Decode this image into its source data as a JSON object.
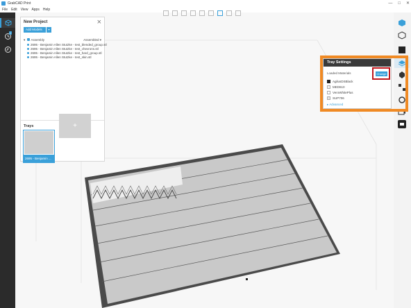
{
  "window": {
    "title": "GrabCAD Print",
    "controls": [
      "—",
      "□",
      "✕"
    ]
  },
  "menu": [
    "File",
    "Edit",
    "View",
    "Apps",
    "Help"
  ],
  "leftbar": {
    "history_badge": "1"
  },
  "project_panel": {
    "title": "New Project",
    "add_models_label": "Add Models",
    "assembly_name": "Assembly",
    "assembly_state": "Assembled",
    "models": [
      "2695 - Benjamin Allen Stutzke - test_blended_group.stl",
      "2695 - Benjamin Allen Stutzke - test_chevrons.stl",
      "2695 - Benjamin Allen Stutzke - test_hard_group.stl",
      "2695 - Benjamin Allen Stutzke - test_skin.stl"
    ],
    "trays_title": "Trays",
    "tray_label": "2695 - Benjamin ...",
    "tray_add_symbol": "+"
  },
  "tray_settings": {
    "title": "Tray Settings",
    "loaded_materials_label": "Loaded Materials",
    "change_label": "Change",
    "materials": [
      {
        "name": "AgilusDSBlack",
        "color": "#222222"
      },
      {
        "name": "MED610",
        "color": "#f2f2f2"
      },
      {
        "name": "VeroWhitePlus",
        "color": "#ffffff"
      },
      {
        "name": "SUP706",
        "color": "#e6e6e6"
      }
    ],
    "advanced_label": "▸ Advanced"
  },
  "colors": {
    "accent": "#3aa0d9",
    "highlight_orange": "#f08a24",
    "highlight_red": "#c0161b"
  },
  "icons": {
    "leftbar": [
      "printer-icon",
      "history-icon",
      "schedule-icon"
    ],
    "rightbar": [
      "view-cube-icon",
      "models-icon",
      "material-icon",
      "tray-settings-icon",
      "orient-icon",
      "arrange-icon",
      "rotate-icon",
      "camera-icon",
      "print-icon"
    ]
  }
}
